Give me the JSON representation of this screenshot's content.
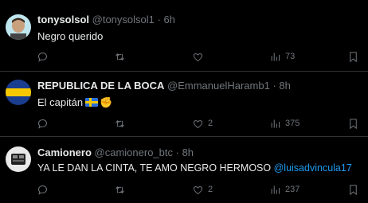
{
  "tweets": [
    {
      "display_name": "tonysolsol",
      "handle": "@tonysolsol1",
      "time": "· 6h",
      "text": "Negro querido",
      "replies": "",
      "retweets": "",
      "likes": "",
      "views": "73"
    },
    {
      "display_name": "REPUBLICA DE LA BOCA",
      "handle": "@EmmanuelHaramb1",
      "time": "· 8h",
      "text": "El capitán",
      "emoji_flag": "sweden-flag",
      "emoji_hand": "✊",
      "replies": "",
      "retweets": "",
      "likes": "2",
      "views": "375"
    },
    {
      "display_name": "Camionero",
      "handle": "@camionero_btc",
      "time": "· 8h",
      "text": "YA LE DAN LA CINTA, TE AMO NEGRO HERMOSO",
      "mention": "@luisadvincula17",
      "replies": "",
      "retweets": "",
      "likes": "2",
      "views": "237"
    }
  ],
  "colors": {
    "background": "#000000",
    "text": "#e7e9ea",
    "secondary": "#71767b",
    "link": "#1d9bf0",
    "divider": "#2f3336"
  }
}
